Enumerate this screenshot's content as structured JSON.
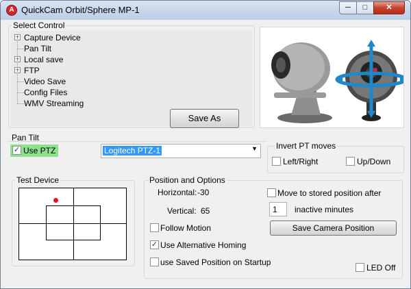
{
  "window": {
    "title": "QuickCam Orbit/Sphere MP-1",
    "app_icon_letter": "A",
    "minimize": "─",
    "maximize": "□",
    "close": "✕"
  },
  "select_control": {
    "legend": "Select Control",
    "items": [
      {
        "label": "Capture Device",
        "expandable": true
      },
      {
        "label": "Pan Tilt",
        "expandable": false
      },
      {
        "label": "Local save",
        "expandable": true
      },
      {
        "label": "FTP",
        "expandable": true
      },
      {
        "label": "Video Save",
        "expandable": false
      },
      {
        "label": "Config Files",
        "expandable": false
      },
      {
        "label": "WMV Streaming",
        "expandable": false
      }
    ],
    "save_as_label": "Save As"
  },
  "pan_tilt": {
    "legend": "Pan Tilt",
    "use_ptz_label": "Use PTZ",
    "use_ptz_checked": true,
    "device_selected": "Logitech PTZ-1"
  },
  "invert": {
    "legend": "Invert PT moves",
    "left_right_label": "Left/Right",
    "up_down_label": "Up/Down"
  },
  "test_device": {
    "legend": "Test Device",
    "dot_color": "#e8141c"
  },
  "position": {
    "legend": "Position and Options",
    "horizontal_label": "Horizontal:",
    "horizontal_value": "-30",
    "vertical_label": "Vertical:",
    "vertical_value": "65",
    "move_stored_label": "Move to stored position after",
    "inactive_value": "1",
    "inactive_minutes_label": "inactive minutes",
    "save_camera_label": "Save Camera Position",
    "follow_motion_label": "Follow Motion",
    "alt_homing_label": "Use Alternative Homing",
    "alt_homing_checked": true,
    "saved_startup_label": "use Saved Position on Startup",
    "led_off_label": "LED Off"
  },
  "colors": {
    "accent_selection": "#3399ff",
    "use_ptz_highlight": "#8ee28e"
  }
}
